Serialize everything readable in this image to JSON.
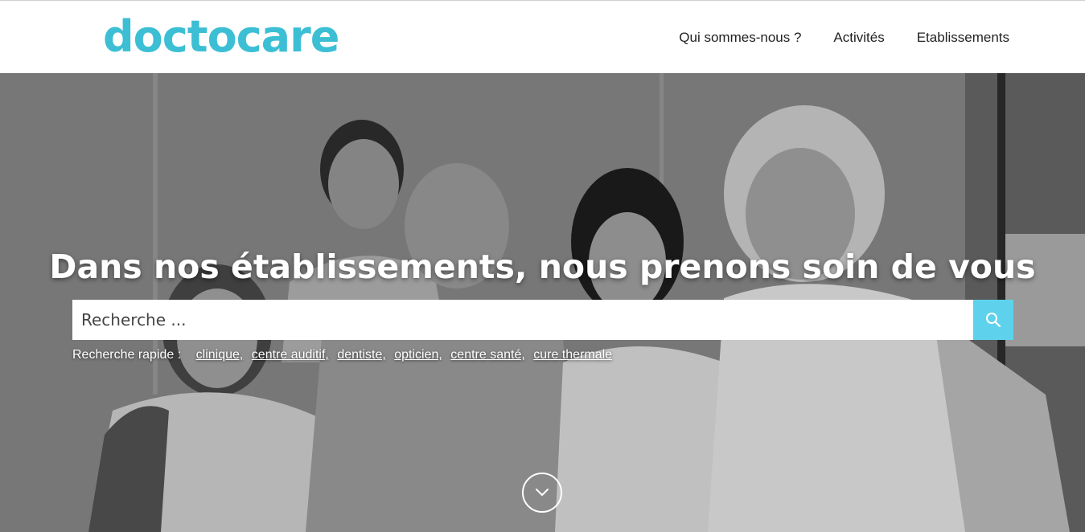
{
  "header": {
    "logo": "doctocare",
    "nav": [
      "Qui sommes-nous ?",
      "Activités",
      "Etablissements"
    ]
  },
  "hero": {
    "title": "Dans nos établissements, nous prenons soin de vous",
    "search": {
      "placeholder": "Recherche ..."
    },
    "quick_search": {
      "label": "Recherche rapide :",
      "links": [
        "clinique,",
        "centre auditif,",
        "dentiste,",
        "opticien,",
        "centre santé,",
        "cure thermale"
      ]
    }
  },
  "colors": {
    "brand": "#3cbfd4",
    "search_button": "#5ed1ec"
  },
  "icons": {
    "search": "search-icon",
    "scroll": "chevron-down-icon"
  }
}
